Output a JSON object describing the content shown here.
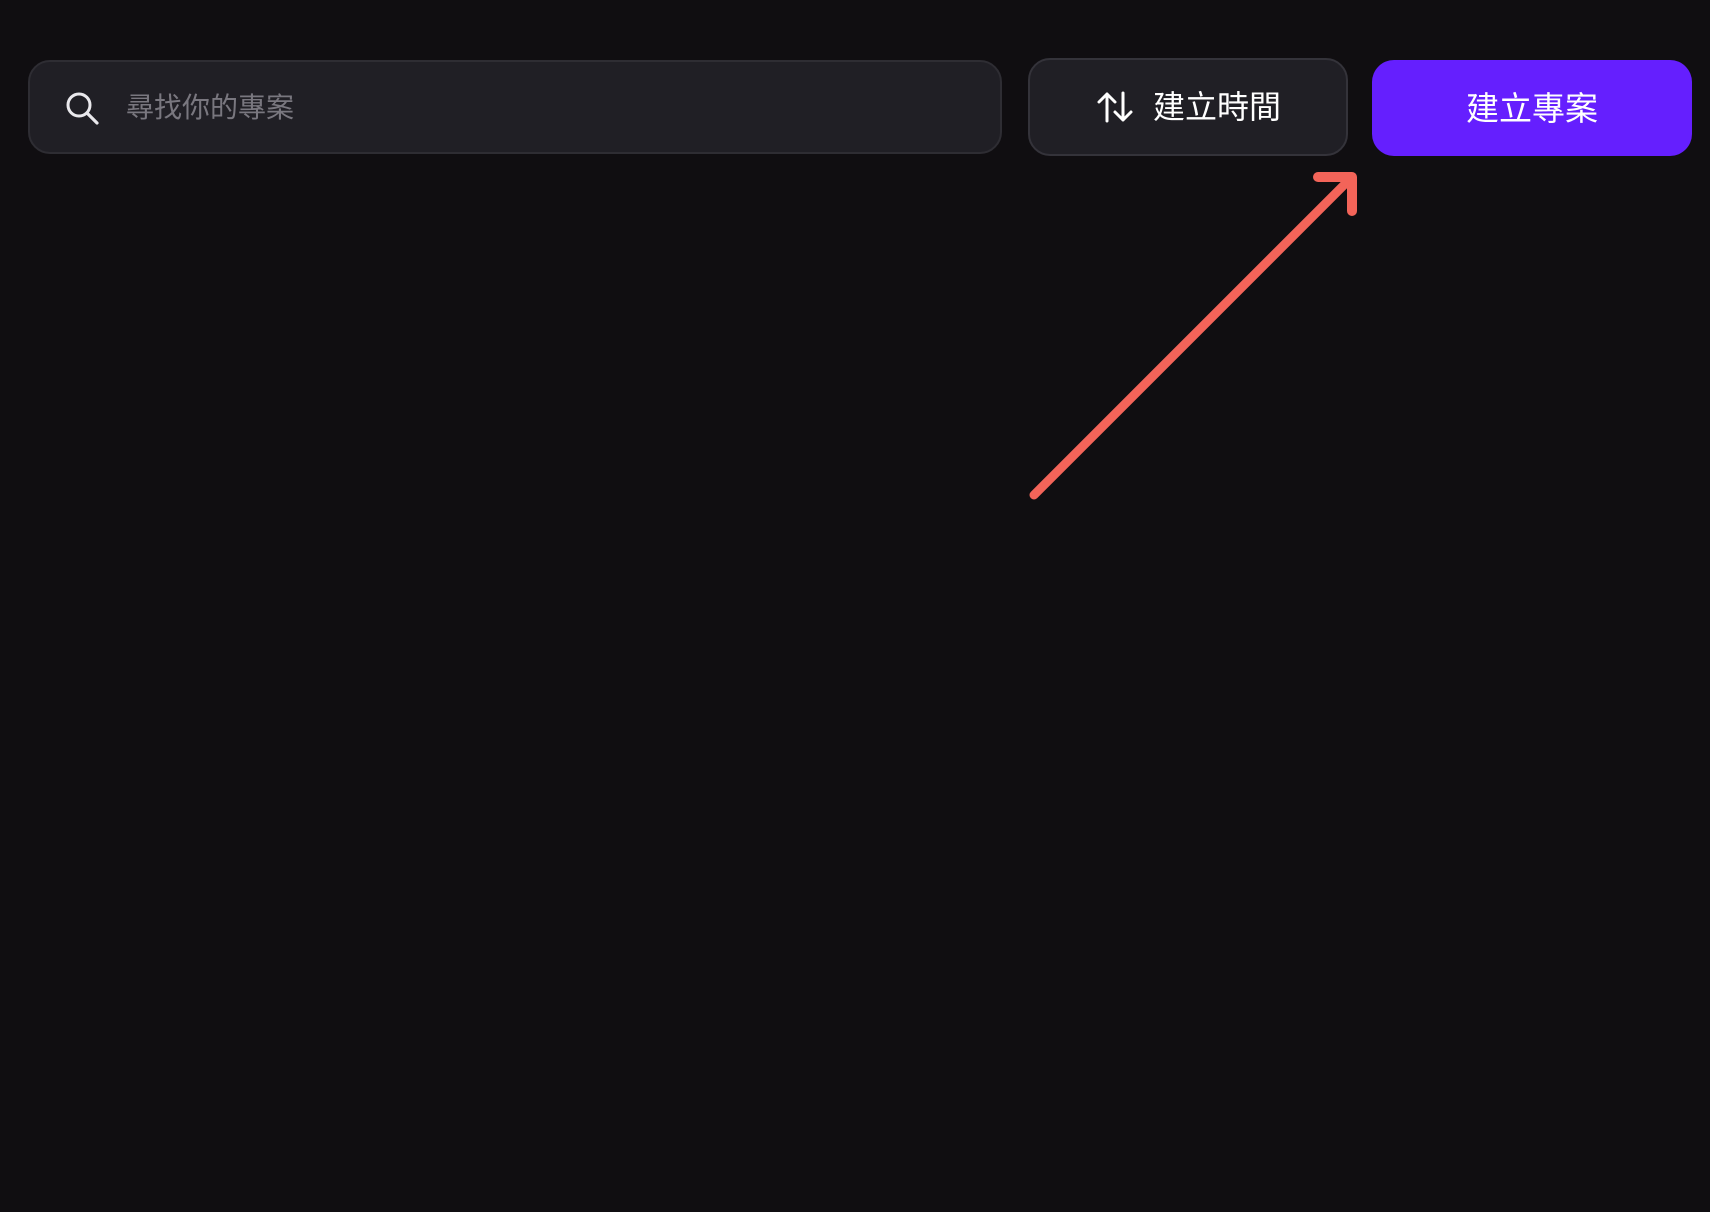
{
  "search": {
    "placeholder": "尋找你的專案",
    "icon": "search-icon"
  },
  "sort_button": {
    "label": "建立時間",
    "icon": "sort-arrows-icon"
  },
  "create_button": {
    "label": "建立專案"
  },
  "annotation": {
    "icon": "arrow-icon",
    "color": "#f36459"
  },
  "colors": {
    "background": "#100e11",
    "accent": "#651ffe",
    "control_background": "#201f25"
  }
}
